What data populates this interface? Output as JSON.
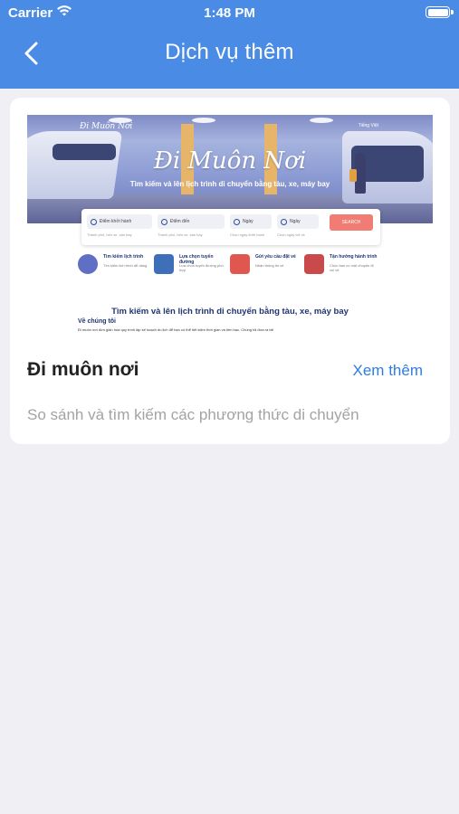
{
  "status_bar": {
    "carrier": "Carrier",
    "time": "1:48 PM"
  },
  "nav": {
    "title": "Dịch vụ thêm"
  },
  "card": {
    "name": "Đi muôn nơi",
    "more_label": "Xem thêm",
    "description": "So sánh và tìm kiếm các phương thức di chuyển",
    "preview": {
      "logo": "Đi Muôn Nơi",
      "lang": "Tiếng Việt",
      "hero_title": "Đi Muôn Nơi",
      "hero_subtitle": "Tìm kiếm và lên lịch trình di chuyển bằng tàu, xe, máy bay",
      "search": {
        "from": "Điểm khởi hành",
        "to": "Điểm đến",
        "date1": "Ngày",
        "date2": "Ngày",
        "hint_from": "Thành phố, bến xe, sân bay",
        "hint_to": "Thành phố, bến xe, sân bay",
        "hint_date1": "Chọn ngày khởi hành",
        "hint_date2": "Chọn ngày trở về",
        "button": "SEARCH"
      },
      "features": [
        {
          "title": "Tìm kiếm lịch trình",
          "text": "Tìm kiếm lịch trình dễ dàng",
          "color": "#5f6fc4"
        },
        {
          "title": "Lựa chọn tuyến đường",
          "text": "Lựa chọn tuyến đường phù hợp",
          "color": "#3f6fb8"
        },
        {
          "title": "Gửi yêu cầu đặt vé",
          "text": "Nhận thông tin vé",
          "color": "#e0574f"
        },
        {
          "title": "Tận hưởng hành trình",
          "text": "Chúc bạn có một chuyến đi vui vẻ",
          "color": "#c94a4a"
        }
      ],
      "text_heading": "Tìm kiếm và lên lịch trình di chuyển bằng tàu, xe, máy bay",
      "text_about": "Về chúng tôi",
      "text_body": "Đi muôn nơi đơn giản hóa quy trình lập kế hoạch du lịch để bạn có thể tiết kiệm thời gian và tiền bạc. Chúng tôi đưa ra tất"
    }
  },
  "colors": {
    "header": "#4a8be6",
    "link": "#2f7de0",
    "background": "#efeff4"
  }
}
